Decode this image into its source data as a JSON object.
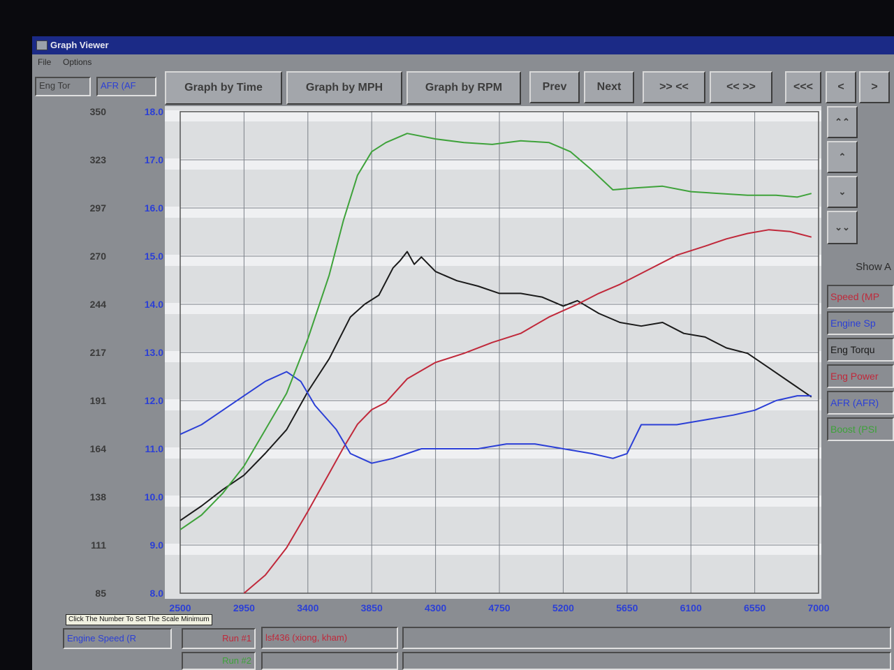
{
  "window": {
    "title": "Graph Viewer"
  },
  "menu": {
    "items": [
      "File",
      "Options"
    ]
  },
  "toolbar": {
    "eng_tor_field": "Eng Tor",
    "afr_field": "AFR (AF",
    "buttons": {
      "graph_by_time": "Graph by Time",
      "graph_by_mph": "Graph by MPH",
      "graph_by_rpm": "Graph by RPM",
      "prev": "Prev",
      "next": "Next",
      "zoom_in": ">> <<",
      "zoom_out": "<< >>",
      "first": "<<<",
      "left": "<",
      "right": ">"
    }
  },
  "scroll_buttons": {
    "top": "⌃⌃",
    "up": "⌃",
    "down": "⌄",
    "bottom": "⌄⌄"
  },
  "legend": {
    "show_all": "Show A",
    "items": [
      {
        "label": "Speed (MP",
        "color": "#c0283a"
      },
      {
        "label": "Engine Sp",
        "color": "#2b3fd6"
      },
      {
        "label": "Eng Torqu",
        "color": "#1a1a1a"
      },
      {
        "label": "Eng Power",
        "color": "#c0283a"
      },
      {
        "label": "AFR (AFR)",
        "color": "#2b3fd6"
      },
      {
        "label": "Boost (PSI",
        "color": "#3ea23a"
      }
    ]
  },
  "bottom": {
    "tooltip": "Click The Number To Set The Scale Minimum",
    "engine_speed_field": "Engine Speed (R",
    "run1_label": "Run #1",
    "run1_name": "lsf436 (xiong, kham)",
    "run2_label": "Run #2"
  },
  "chart_data": {
    "type": "line",
    "left_axis_ticks": [
      "350",
      "323",
      "297",
      "270",
      "244",
      "217",
      "191",
      "164",
      "138",
      "111",
      "85"
    ],
    "afr_axis_ticks": [
      "18.0",
      "17.0",
      "16.0",
      "15.0",
      "14.0",
      "13.0",
      "12.0",
      "11.0",
      "10.0",
      "9.0",
      "8.0"
    ],
    "x_ticks": [
      "2500",
      "2950",
      "3400",
      "3850",
      "4300",
      "4750",
      "5200",
      "5650",
      "6100",
      "6550",
      "7000"
    ],
    "xlim": [
      2500,
      7000
    ],
    "left_ylim": [
      85,
      350
    ],
    "afr_ylim": [
      8.0,
      18.0
    ],
    "grid": true,
    "series": [
      {
        "name": "Eng Torqu",
        "color": "#1a1a1a",
        "axis": "left",
        "x": [
          2500,
          2650,
          2800,
          2950,
          3100,
          3250,
          3400,
          3550,
          3700,
          3800,
          3900,
          4000,
          4050,
          4100,
          4150,
          4200,
          4300,
          4450,
          4600,
          4750,
          4900,
          5050,
          5200,
          5300,
          5450,
          5600,
          5750,
          5900,
          6050,
          6200,
          6350,
          6500,
          6650,
          6800,
          6950
        ],
        "y": [
          125,
          133,
          142,
          150,
          162,
          175,
          196,
          214,
          237,
          244,
          249,
          264,
          268,
          273,
          266,
          270,
          262,
          257,
          254,
          250,
          250,
          248,
          243,
          246,
          239,
          234,
          232,
          234,
          228,
          226,
          220,
          217,
          209,
          201,
          193
        ]
      },
      {
        "name": "Eng Power",
        "color": "#c0283a",
        "axis": "left",
        "x": [
          2950,
          3100,
          3250,
          3400,
          3550,
          3650,
          3750,
          3850,
          3950,
          4100,
          4300,
          4500,
          4700,
          4900,
          5100,
          5300,
          5450,
          5600,
          5800,
          6000,
          6200,
          6350,
          6500,
          6650,
          6800,
          6950
        ],
        "y": [
          85,
          95,
          110,
          130,
          151,
          165,
          178,
          186,
          190,
          203,
          212,
          217,
          223,
          228,
          237,
          244,
          250,
          255,
          263,
          271,
          276,
          280,
          283,
          285,
          284,
          281
        ]
      },
      {
        "name": "AFR (AFR)",
        "color": "#2b3fd6",
        "axis": "afr",
        "x": [
          2500,
          2650,
          2800,
          2950,
          3100,
          3250,
          3350,
          3450,
          3600,
          3700,
          3850,
          4000,
          4200,
          4400,
          4600,
          4800,
          5000,
          5200,
          5400,
          5550,
          5650,
          5750,
          5850,
          6000,
          6200,
          6400,
          6550,
          6700,
          6850,
          6950
        ],
        "y": [
          11.3,
          11.5,
          11.8,
          12.1,
          12.4,
          12.6,
          12.4,
          11.9,
          11.4,
          10.9,
          10.7,
          10.8,
          11.0,
          11.0,
          11.0,
          11.1,
          11.1,
          11.0,
          10.9,
          10.8,
          10.9,
          11.5,
          11.5,
          11.5,
          11.6,
          11.7,
          11.8,
          12.0,
          12.1,
          12.1
        ]
      },
      {
        "name": "Boost (PSI",
        "color": "#3ea23a",
        "axis": "left",
        "x": [
          2500,
          2650,
          2800,
          2950,
          3100,
          3250,
          3400,
          3550,
          3650,
          3750,
          3850,
          3950,
          4100,
          4300,
          4500,
          4700,
          4900,
          5100,
          5250,
          5400,
          5550,
          5700,
          5900,
          6100,
          6300,
          6500,
          6700,
          6850,
          6950
        ],
        "y": [
          120,
          128,
          140,
          155,
          175,
          195,
          225,
          260,
          290,
          315,
          328,
          333,
          338,
          335,
          333,
          332,
          334,
          333,
          328,
          318,
          307,
          308,
          309,
          306,
          305,
          304,
          304,
          303,
          305
        ]
      }
    ]
  }
}
